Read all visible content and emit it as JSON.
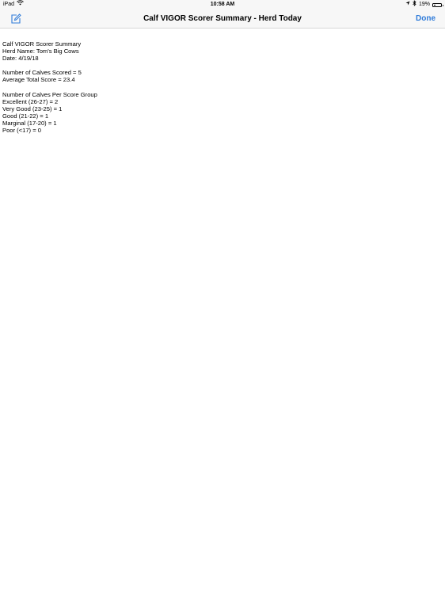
{
  "status_bar": {
    "device": "iPad",
    "time": "10:58 AM",
    "battery": "19%",
    "icons": [
      "wifi-icon",
      "location-icon",
      "bluetooth-icon",
      "battery-icon"
    ]
  },
  "nav": {
    "title": "Calf VIGOR Scorer Summary - Herd Today",
    "done_label": "Done",
    "left_icon": "compose-icon",
    "accent_color": "#2f7bd9"
  },
  "summary": {
    "header_lines": [
      "Calf VIGOR Scorer Summary",
      "Herd Name: Tom's Big Cows",
      "Date: 4/19/18"
    ],
    "stats_lines": [
      "Number of Calves Scored = 5",
      "Average Total Score = 23.4"
    ],
    "group_lines": [
      "Number of Calves Per Score Group",
      "Excellent (26-27) = 2",
      "Very Good (23-25) = 1",
      "Good (21-22) = 1",
      "Marginal (17-20) = 1",
      "Poor (<17) = 0"
    ]
  }
}
